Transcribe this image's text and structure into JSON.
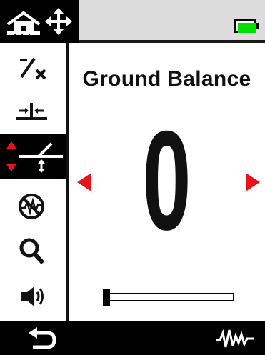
{
  "header": {
    "icons": [
      "home-mode-icon",
      "move-icon"
    ],
    "battery": {
      "level": 1.0,
      "color": "#00e000"
    }
  },
  "sidebar": {
    "items": [
      {
        "icon": "percent-x-icon",
        "active": false
      },
      {
        "icon": "noise-cancel-icon",
        "active": false
      },
      {
        "icon": "ground-balance-icon",
        "active": true
      },
      {
        "icon": "iron-bias-icon",
        "active": false
      },
      {
        "icon": "search-icon",
        "active": false
      },
      {
        "icon": "volume-icon",
        "active": false
      }
    ]
  },
  "main": {
    "title": "Ground Balance",
    "value": "0",
    "slider_value": 0.0,
    "accent_color": "#e8141c"
  },
  "footer": {
    "icons": [
      "back-icon",
      "waveform-icon"
    ]
  }
}
